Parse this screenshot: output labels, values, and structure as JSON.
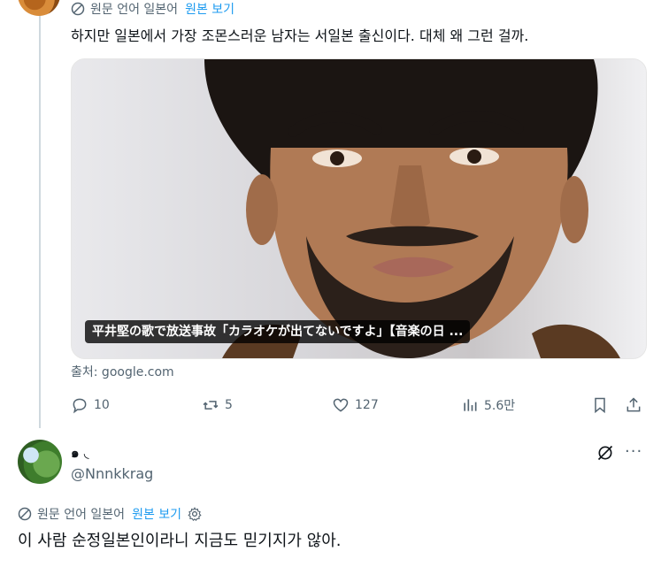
{
  "thread": {
    "translation": {
      "label": "원문 언어 일본어",
      "link": "원본 보기"
    },
    "text": "하지만 일본에서 가장 조몬스러운 남자는 서일본 출신이다. 대체 왜 그런 걸까.",
    "card": {
      "caption": "平井堅の歌で放送事故「カラオケが出てないですよ」【音楽の日 ...",
      "source": "출처: google.com"
    },
    "actions": {
      "replies": "10",
      "retweets": "5",
      "likes": "127",
      "views": "5.6만"
    }
  },
  "reply": {
    "display_name": "๑ ◟",
    "handle": "@Nnnkkrag",
    "translation": {
      "label": "원문 언어 일본어",
      "link": "원본 보기"
    },
    "text": "이 사람 순정일본인이라니 지금도 믿기지가 않아."
  },
  "colors": {
    "accent": "#1d9bf0",
    "muted": "#536471",
    "text": "#0f1419",
    "line": "#cfd9de"
  },
  "icons": [
    "translate-icon",
    "reply-icon",
    "retweet-icon",
    "like-icon",
    "views-icon",
    "bookmark-icon",
    "share-icon",
    "grok-icon",
    "more-icon",
    "settings-icon"
  ]
}
